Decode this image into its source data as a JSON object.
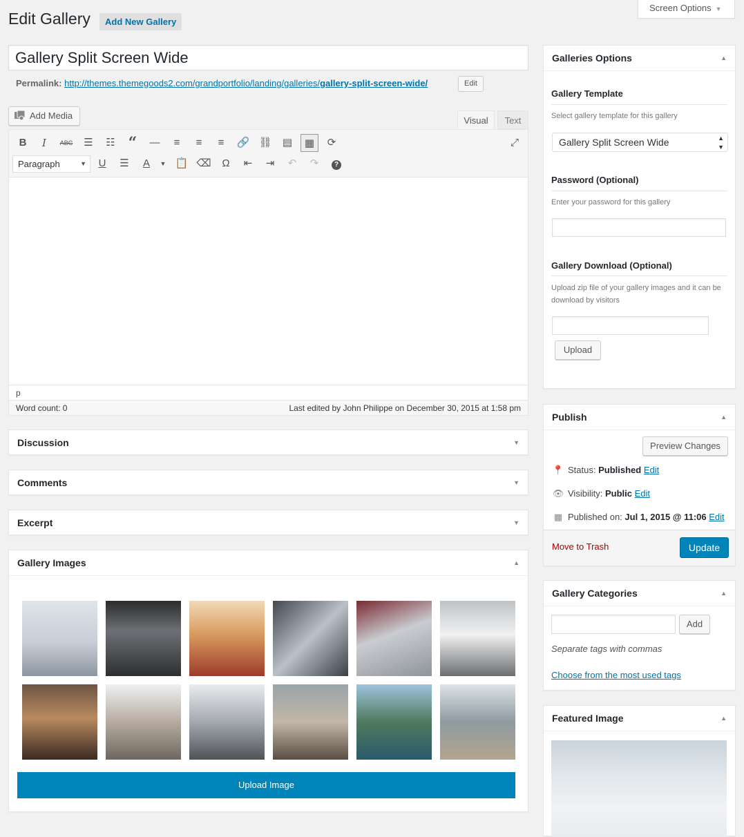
{
  "header": {
    "title": "Edit Gallery",
    "add_new": "Add New Gallery",
    "screen_options": "Screen Options"
  },
  "post": {
    "title": "Gallery Split Screen Wide",
    "permalink_label": "Permalink:",
    "permalink_base": "http://themes.themegoods2.com/grandportfolio/landing/galleries/",
    "permalink_slug": "gallery-split-screen-wide/",
    "permalink_edit": "Edit"
  },
  "editor": {
    "add_media": "Add Media",
    "tab_visual": "Visual",
    "tab_text": "Text",
    "format_select": "Paragraph",
    "path": "p",
    "word_count": "Word count: 0",
    "last_edited": "Last edited by John Philippe on December 30, 2015 at 1:58 pm",
    "toolbar_row1": [
      "bold-icon",
      "italic-icon",
      "strikethrough-icon",
      "bullet-list-icon",
      "numbered-list-icon",
      "blockquote-icon",
      "horizontal-rule-icon",
      "align-left-icon",
      "align-center-icon",
      "align-right-icon",
      "link-icon",
      "unlink-icon",
      "read-more-icon",
      "toolbar-toggle-icon",
      "refresh-icon"
    ],
    "toolbar_row2": [
      "underline-icon",
      "justify-icon",
      "text-color-icon",
      "paste-text-icon",
      "clear-format-icon",
      "special-char-icon",
      "outdent-icon",
      "indent-icon",
      "undo-icon",
      "redo-icon",
      "help-icon"
    ]
  },
  "boxes": {
    "discussion": "Discussion",
    "comments": "Comments",
    "excerpt": "Excerpt"
  },
  "gallery_images": {
    "title": "Gallery Images",
    "upload_button": "Upload Image",
    "images": [
      {
        "name": "woman-pier"
      },
      {
        "name": "window-bedroom"
      },
      {
        "name": "woman-red-scarf"
      },
      {
        "name": "skyscrapers"
      },
      {
        "name": "car-door-handle"
      },
      {
        "name": "woman-subway"
      },
      {
        "name": "dining-table"
      },
      {
        "name": "woman-hat-road"
      },
      {
        "name": "mountain-road"
      },
      {
        "name": "phone-in-hand"
      },
      {
        "name": "coastal-rocks"
      },
      {
        "name": "lake-mountains"
      }
    ],
    "remove_color": "#e32b22"
  },
  "galleries_options": {
    "title": "Galleries Options",
    "template_label": "Gallery Template",
    "template_desc": "Select gallery template for this gallery",
    "template_value": "Gallery Split Screen Wide",
    "password_label": "Password (Optional)",
    "password_desc": "Enter your password for this gallery",
    "download_label": "Gallery Download (Optional)",
    "download_desc": "Upload zip file of your gallery images and it can be download by visitors",
    "upload_button": "Upload"
  },
  "publish": {
    "title": "Publish",
    "preview_button": "Preview Changes",
    "status_label": "Status:",
    "status_value": "Published",
    "visibility_label": "Visibility:",
    "visibility_value": "Public",
    "published_label": "Published on:",
    "published_value": "Jul 1, 2015 @ 11:06",
    "edit_link": "Edit",
    "trash_link": "Move to Trash",
    "update_button": "Update"
  },
  "categories": {
    "title": "Gallery Categories",
    "add_button": "Add",
    "hint": "Separate tags with commas",
    "choose_link": "Choose from the most used tags"
  },
  "featured_image": {
    "title": "Featured Image"
  },
  "colors": {
    "primary": "#0085ba",
    "link": "#0073aa",
    "trash": "#aa0000"
  }
}
